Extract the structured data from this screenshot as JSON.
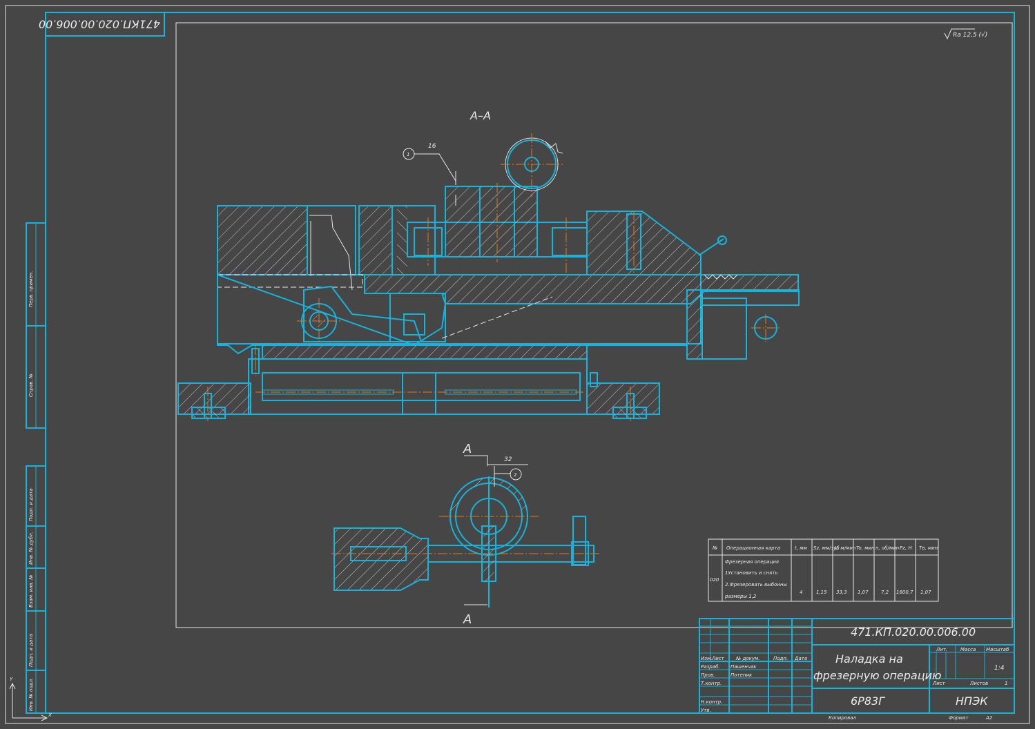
{
  "stamp_top": "471КП.020.00.006.00",
  "roughness": "Ra 12,5 (√)",
  "section_label": "А–А",
  "dim_16": "16",
  "dim_32": "32",
  "callout_1": "1",
  "callout_2": "2",
  "section_mark_top": "А",
  "section_mark_bottom": "А",
  "side_labels": [
    "Перв. примен.",
    "Справ. №",
    "Подп. и дата",
    "Инв. № дубл.",
    "Взам. инв. №",
    "Подп. и дата",
    "Инв. № подл."
  ],
  "op_table": {
    "headers": [
      "№",
      "Операционная карта",
      "t, мм",
      "Sz, мм/зуб",
      "V, м/мин",
      "To, мин",
      "n, об/мин",
      "Pz, Н",
      "Tв, мин"
    ],
    "number": "020",
    "op_lines": [
      "Фрезерная операция",
      "1Установить и снять",
      "2.Фрезеровать выбоины",
      "размеры 1,2"
    ],
    "values": [
      "4",
      "1,15",
      "33,3",
      "1,07",
      "7,2",
      "1600,7",
      "1,07"
    ]
  },
  "title_block": {
    "designation": "471.КП.020.00.006.00",
    "name_line1": "Наладка на",
    "name_line2": "фрезерную операцию",
    "machine": "6Р83Г",
    "org": "НПЭК",
    "col_headers": [
      "Изм.",
      "Лист",
      "№ докум.",
      "Подп.",
      "Дата"
    ],
    "rows": [
      {
        "role": "Разраб.",
        "name": "Пашенчак"
      },
      {
        "role": "Пров.",
        "name": "Потепик"
      },
      {
        "role": "Т.контр.",
        "name": ""
      },
      {
        "role": "Н.контр.",
        "name": ""
      },
      {
        "role": "Утв.",
        "name": ""
      }
    ],
    "lit_label": "Лит.",
    "mass_label": "Масса",
    "scale_label": "Масштаб",
    "scale_value": "1:4",
    "sheet_label": "Лист",
    "sheets_label": "Листов",
    "sheets_value": "1",
    "copied": "Копировал",
    "format_label": "Формат",
    "format_value": "А2"
  },
  "axis_y": "Y",
  "axis_x": "X"
}
